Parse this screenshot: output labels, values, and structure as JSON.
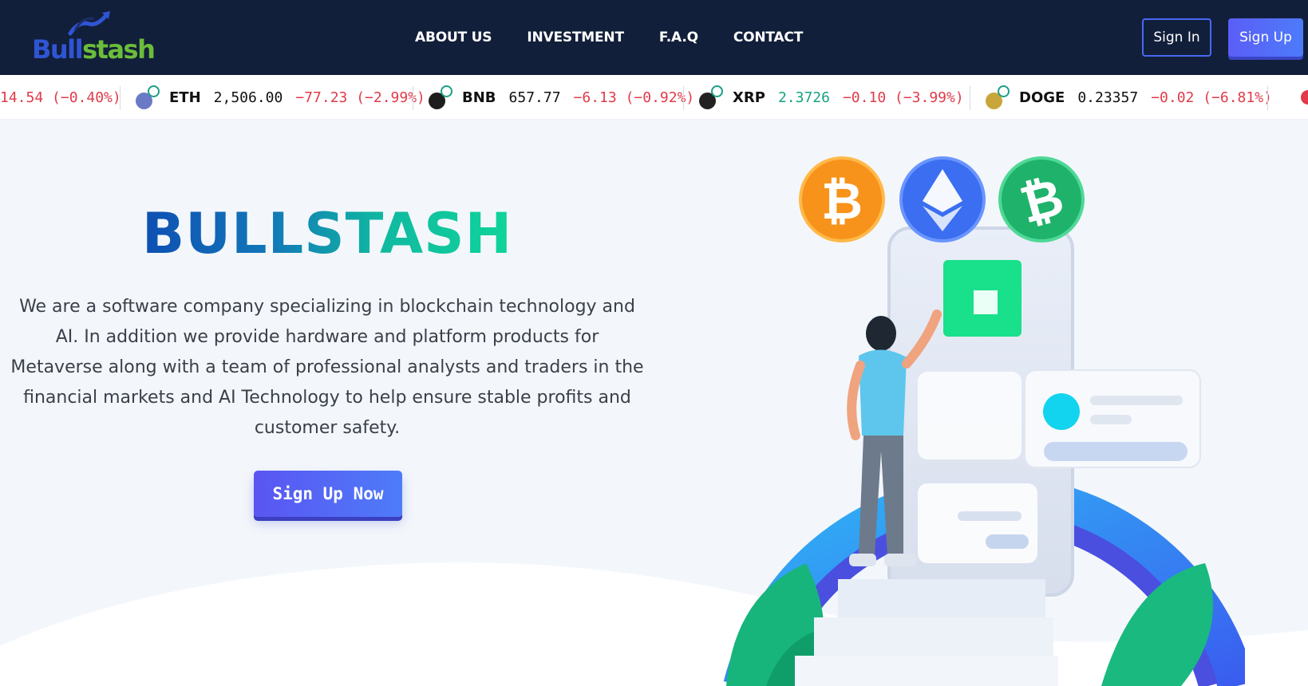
{
  "nav": {
    "logo_part1": "Bull",
    "logo_part2": "stash",
    "links": [
      "ABOUT US",
      "INVESTMENT",
      "F.A.Q",
      "CONTACT"
    ],
    "signin_label": "Sign In",
    "signup_label": "Sign Up"
  },
  "ticker": {
    "partial_change": "14.54 (−0.40%)",
    "items": [
      {
        "symbol": "ETH",
        "price": "2,506.00",
        "change": "−77.23 (−2.99%)",
        "icon": "ethereum-icon",
        "color": "#6a7ac6"
      },
      {
        "symbol": "BNB",
        "price": "657.77",
        "change": "−6.13 (−0.92%)",
        "icon": "bnb-icon",
        "color": "#1e1e1e"
      },
      {
        "symbol": "XRP",
        "price": "2.3726",
        "change": "−0.10 (−3.99%)",
        "icon": "xrp-icon",
        "color": "#222222"
      },
      {
        "symbol": "DOGE",
        "price": "0.23357",
        "change": "−0.02 (−6.81%)",
        "icon": "dogecoin-icon",
        "color": "#c9a63c"
      }
    ],
    "colors": {
      "up": "#16a383",
      "down": "#e03b4a"
    }
  },
  "hero": {
    "title": "BULLSTASH",
    "description": "We are a software company specializing in blockchain technology and AI. In addition we provide hardware and platform products for Metaverse along with a team of professional analysts and traders in the financial markets and AI Technology to help ensure stable profits and customer safety.",
    "cta_label": "Sign Up Now",
    "illustration_icons": [
      "bitcoin-icon",
      "ethereum-icon",
      "bitcoin-cash-icon"
    ]
  },
  "colors": {
    "navbar_bg": "#121f3a",
    "accent": "#5b5ef7",
    "hero_bg": "#f3f7fb"
  }
}
